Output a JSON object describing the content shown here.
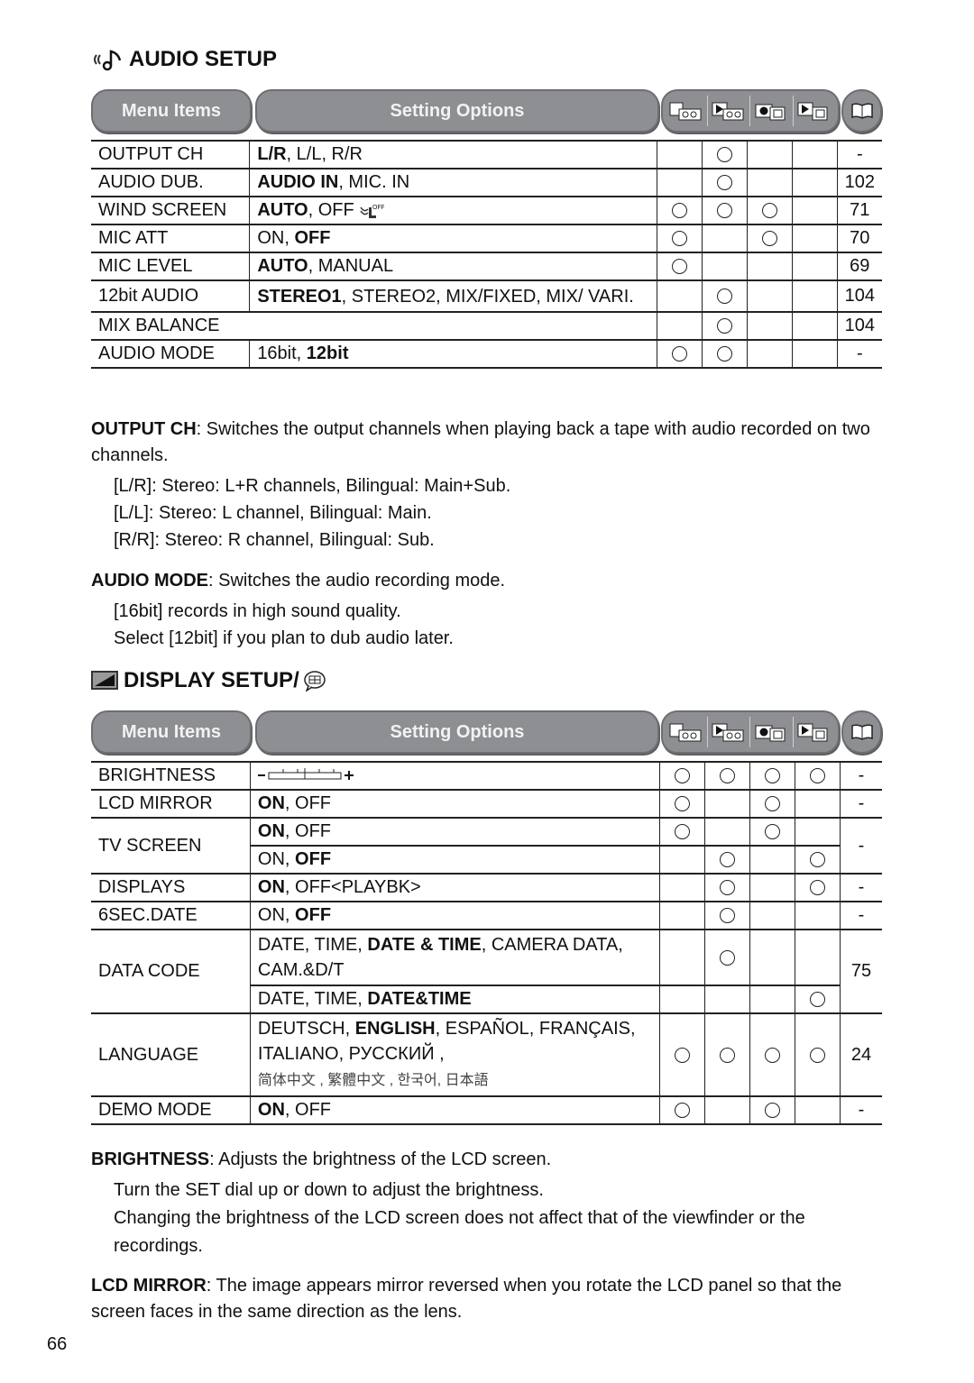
{
  "audio_setup": {
    "title": "AUDIO SETUP",
    "icon": "audio-note-icon",
    "header": {
      "menu_items": "Menu Items",
      "setting_options": "Setting Options",
      "mode_icons": [
        "camera-tape-icon",
        "play-tape-icon",
        "camera-card-icon",
        "play-card-icon"
      ],
      "page_icon": "book-icon"
    },
    "rows": [
      {
        "item": "OUTPUT CH",
        "options": [
          {
            "t": "L/R",
            "b": true
          },
          {
            "t": ", L/L, R/R",
            "b": false
          }
        ],
        "modes": [
          0,
          1,
          0,
          0
        ],
        "page": "-"
      },
      {
        "item": "AUDIO DUB.",
        "options": [
          {
            "t": "AUDIO IN",
            "b": true
          },
          {
            "t": ", MIC. IN",
            "b": false
          }
        ],
        "modes": [
          0,
          1,
          0,
          0
        ],
        "page": "102"
      },
      {
        "item": "WIND SCREEN",
        "options": [
          {
            "t": "AUTO",
            "b": true
          },
          {
            "t": ", OFF ",
            "b": false
          }
        ],
        "extra_icon": "wind-off-icon",
        "modes": [
          1,
          1,
          1,
          0
        ],
        "page": "71"
      },
      {
        "item": "MIC ATT",
        "options": [
          {
            "t": "ON, ",
            "b": false
          },
          {
            "t": "OFF",
            "b": true
          }
        ],
        "modes": [
          1,
          0,
          1,
          0
        ],
        "page": "70"
      },
      {
        "item": "MIC LEVEL",
        "options": [
          {
            "t": "AUTO",
            "b": true
          },
          {
            "t": ", MANUAL",
            "b": false
          }
        ],
        "modes": [
          1,
          0,
          0,
          0
        ],
        "page": "69"
      },
      {
        "item": "12bit AUDIO",
        "options": [
          {
            "t": "STEREO1",
            "b": true
          },
          {
            "t": ", STEREO2, MIX/FIXED, MIX/ VARI.",
            "b": false
          }
        ],
        "modes": [
          0,
          1,
          0,
          0
        ],
        "page": "104"
      },
      {
        "item": "MIX BALANCE",
        "options": [],
        "span": true,
        "modes": [
          0,
          1,
          0,
          0
        ],
        "page": "104"
      },
      {
        "item": "AUDIO MODE",
        "options": [
          {
            "t": "16bit, ",
            "b": false
          },
          {
            "t": "12bit",
            "b": true
          }
        ],
        "modes": [
          1,
          1,
          0,
          0
        ],
        "page": "-"
      }
    ],
    "notes": {
      "output_ch_label": "OUTPUT CH",
      "output_ch_text": ": Switches the output channels when playing back a tape with audio recorded on two channels.",
      "lr": "[L/R]:  Stereo: L+R channels, Bilingual: Main+Sub.",
      "ll": "[L/L]:  Stereo: L channel, Bilingual: Main.",
      "rr": "[R/R]: Stereo: R channel, Bilingual: Sub.",
      "audio_mode_label": "AUDIO MODE",
      "audio_mode_text": ": Switches the audio recording mode.",
      "m16": "[16bit] records in high sound quality.",
      "m12": "Select [12bit] if you plan to dub audio later."
    }
  },
  "display_setup": {
    "title": "DISPLAY SETUP/",
    "icon": "display-icon",
    "title_icon2": "speech-bubble-icon",
    "header": {
      "menu_items": "Menu Items",
      "setting_options": "Setting Options"
    },
    "rows": {
      "brightness": {
        "item": "BRIGHTNESS",
        "modes": [
          1,
          1,
          1,
          1
        ],
        "page": "-"
      },
      "lcd_mirror": {
        "item": "LCD MIRROR",
        "a": "ON",
        "b": ", OFF",
        "modes": [
          1,
          0,
          1,
          0
        ],
        "page": "-"
      },
      "tv_screen": {
        "item": "TV SCREEN",
        "r1a": "ON",
        "r1b": ", OFF",
        "r1modes": [
          1,
          0,
          1,
          0
        ],
        "r2a": "ON, ",
        "r2b": "OFF",
        "r2modes": [
          0,
          1,
          0,
          1
        ],
        "page": "-"
      },
      "displays": {
        "item": "DISPLAYS",
        "a": "ON",
        "b": ", OFF<PLAYBK>",
        "modes": [
          0,
          1,
          0,
          1
        ],
        "page": "-"
      },
      "sec_date": {
        "item": "6SEC.DATE",
        "a": "ON, ",
        "b": "OFF",
        "modes": [
          0,
          1,
          0,
          0
        ],
        "page": "-"
      },
      "data_code": {
        "item": "DATA CODE",
        "r1a": "DATE, TIME, ",
        "r1b": "DATE & TIME",
        "r1c": ", CAMERA DATA, CAM.&D/T",
        "r1modes": [
          0,
          1,
          0,
          0
        ],
        "r2a": "DATE, TIME, ",
        "r2b": "DATE&TIME",
        "r2modes": [
          0,
          0,
          0,
          1
        ],
        "page": "75"
      },
      "language": {
        "item": "LANGUAGE",
        "a": "DEUTSCH, ",
        "b": "ENGLISH",
        "c": ", ESPAÑOL, FRANÇAIS, ITALIANO, РУССКИЙ ,",
        "d": "简体中文 , 繁體中文 , 한국어, 日本語",
        "modes": [
          1,
          1,
          1,
          1
        ],
        "page": "24"
      },
      "demo_mode": {
        "item": "DEMO MODE",
        "a": "ON",
        "b": ", OFF",
        "modes": [
          1,
          0,
          1,
          0
        ],
        "page": "-"
      }
    },
    "notes": {
      "brightness_label": "BRIGHTNESS",
      "brightness_text": ": Adjusts the brightness of the LCD screen.",
      "b1": "Turn the SET dial up or down to adjust the brightness.",
      "b2": "Changing the brightness of the LCD screen does not affect that of the viewfinder or the recordings.",
      "lcd_label": "LCD MIRROR",
      "lcd_text": ": The image appears mirror reversed when you rotate the LCD panel so that the screen faces in the same direction as the lens."
    }
  },
  "page_number": "66"
}
